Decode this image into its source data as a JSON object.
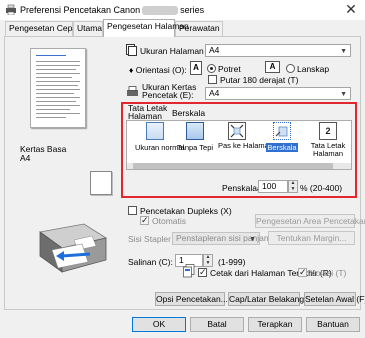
{
  "window": {
    "title_prefix": "Preferensi Pencetakan Canon",
    "title_suffix": "series",
    "close": "✕"
  },
  "tabs": [
    {
      "label": "Pengesetan Cepat"
    },
    {
      "label": "Utama"
    },
    {
      "label": "Pengesetan Halaman"
    },
    {
      "label": "Perawatan"
    }
  ],
  "preview": {
    "paper_label": "Kertas Basa",
    "paper_size": "A4"
  },
  "page_size": {
    "label": "Ukuran Halaman (Z):",
    "value": "A4"
  },
  "orientation": {
    "label": "Orientasi (O):",
    "portrait": "Potret",
    "landscape": "Lanskap",
    "rotate": "Putar 180 derajat (T)"
  },
  "printer_paper": {
    "label": "Ukuran Kertas Pencetak (E):",
    "value": "A4"
  },
  "page_layout": {
    "label": "Tata Letak Halaman (Y):",
    "current": "Berskala",
    "options": [
      {
        "label": "Ukuran normal"
      },
      {
        "label": "Tanpa Tepi"
      },
      {
        "label": "Pas ke Halaman"
      },
      {
        "label": "Berskala"
      },
      {
        "label": "Tata Letak Halaman"
      }
    ]
  },
  "scaling": {
    "label": "Penskalaan:",
    "value": "100",
    "range": "% (20-400)"
  },
  "duplex": {
    "label": "Pencetakan Dupleks (X)",
    "auto": "Otomatis",
    "area_button": "Pengesetan Area Pencetakan..."
  },
  "stapling": {
    "label": "Sisi Stapler (I):",
    "value": "Penstapleran sisi panjang (Kri)",
    "margin_button": "Tentukan Margin..."
  },
  "copies": {
    "label": "Salinan (C):",
    "value": "1",
    "range": "(1-999)",
    "reverse": "Cetak dari Halaman Terakhir (R)",
    "collate": "Kolasi (T)"
  },
  "buttons": {
    "print_options": "Opsi Pencetakan...",
    "stamp_bg": "Cap/Latar Belakang...",
    "defaults": "Setelan Awal (F)",
    "ok": "OK",
    "cancel": "Batal",
    "apply": "Terapkan",
    "help": "Bantuan"
  },
  "colors": {
    "highlight_border": "#e4262f",
    "selection": "#2f6fd0"
  }
}
